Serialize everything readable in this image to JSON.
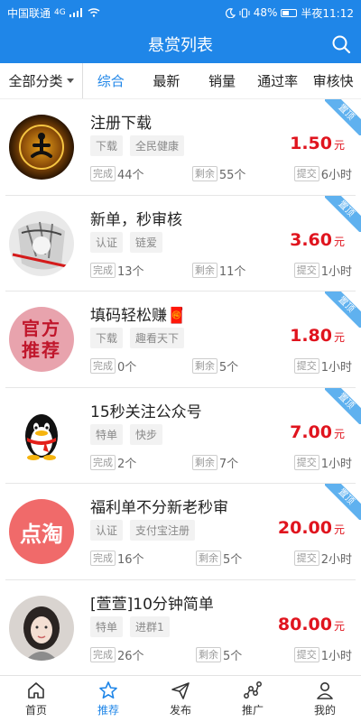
{
  "status": {
    "carrier": "中国联通",
    "network": "4G",
    "battery": "48%",
    "time": "半夜11:12"
  },
  "header": {
    "title": "悬赏列表"
  },
  "tabs": {
    "all": "全部分类",
    "items": [
      "综合",
      "最新",
      "销量",
      "通过率",
      "审核快"
    ],
    "active": 0
  },
  "meta_labels": {
    "done": "完成",
    "remain": "剩余",
    "submit": "提交"
  },
  "currency": "元",
  "ribbon": "置顶",
  "tasks": [
    {
      "title": "注册下载",
      "tags": [
        "下载",
        "全民健康"
      ],
      "price": "1.50",
      "done": "44个",
      "remain": "55个",
      "submit": "6小时",
      "pinned": true
    },
    {
      "title": "新单，秒审核",
      "tags": [
        "认证",
        "链爱"
      ],
      "price": "3.60",
      "done": "13个",
      "remain": "11个",
      "submit": "1小时",
      "pinned": true
    },
    {
      "title": "填码轻松赚🧧",
      "tags": [
        "下载",
        "趣看天下"
      ],
      "price": "1.80",
      "done": "0个",
      "remain": "5个",
      "submit": "1小时",
      "pinned": true,
      "avatar_text": "官方推荐"
    },
    {
      "title": "15秒关注公众号",
      "tags": [
        "特单",
        "快步"
      ],
      "price": "7.00",
      "done": "2个",
      "remain": "7个",
      "submit": "1小时",
      "pinned": true
    },
    {
      "title": "福利单不分新老秒审",
      "tags": [
        "认证",
        "支付宝注册"
      ],
      "price": "20.00",
      "done": "16个",
      "remain": "5个",
      "submit": "2小时",
      "pinned": true,
      "avatar_text": "点淘"
    },
    {
      "title": "[萱萱]10分钟简单",
      "tags": [
        "特单",
        "进群1"
      ],
      "price": "80.00",
      "done": "26个",
      "remain": "5个",
      "submit": "1小时",
      "pinned": false
    }
  ],
  "nav": [
    {
      "label": "首页",
      "icon": "home-icon"
    },
    {
      "label": "推荐",
      "icon": "star-icon"
    },
    {
      "label": "发布",
      "icon": "send-icon"
    },
    {
      "label": "推广",
      "icon": "share-icon"
    },
    {
      "label": "我的",
      "icon": "user-icon"
    }
  ],
  "colors": {
    "brand": "#1f86e8",
    "price": "#e0141e",
    "ribbon": "#5fb1ef"
  }
}
